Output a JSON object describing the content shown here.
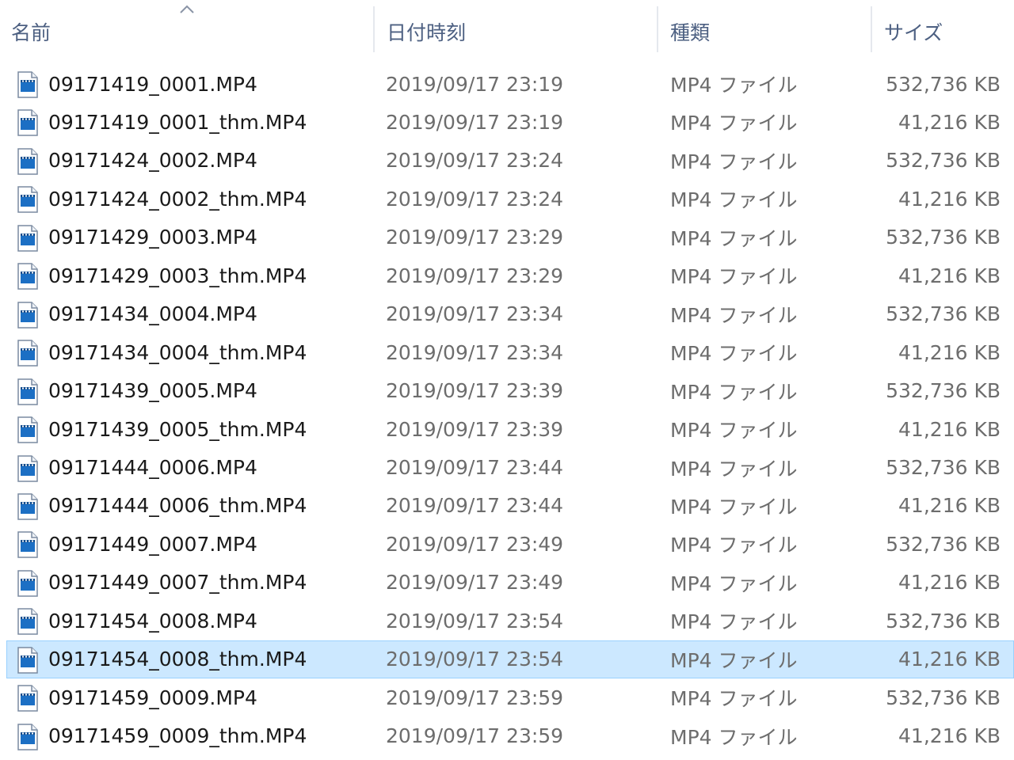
{
  "columns": {
    "name": "名前",
    "date": "日付時刻",
    "type": "種類",
    "size": "サイズ"
  },
  "sort": {
    "column": "name",
    "direction": "ascending",
    "icon": "chevron-up-icon"
  },
  "colors": {
    "header_text": "#4d6082",
    "selected_bg": "#cce8ff",
    "selected_border": "#99d1ff",
    "icon_blue": "#1c6fc4"
  },
  "files": [
    {
      "name": "09171419_0001.MP4",
      "date": "2019/09/17 23:19",
      "type": "MP4 ファイル",
      "size": "532,736 KB",
      "icon": "video-file-icon"
    },
    {
      "name": "09171419_0001_thm.MP4",
      "date": "2019/09/17 23:19",
      "type": "MP4 ファイル",
      "size": "41,216 KB",
      "icon": "video-file-icon"
    },
    {
      "name": "09171424_0002.MP4",
      "date": "2019/09/17 23:24",
      "type": "MP4 ファイル",
      "size": "532,736 KB",
      "icon": "video-file-icon"
    },
    {
      "name": "09171424_0002_thm.MP4",
      "date": "2019/09/17 23:24",
      "type": "MP4 ファイル",
      "size": "41,216 KB",
      "icon": "video-file-icon"
    },
    {
      "name": "09171429_0003.MP4",
      "date": "2019/09/17 23:29",
      "type": "MP4 ファイル",
      "size": "532,736 KB",
      "icon": "video-file-icon"
    },
    {
      "name": "09171429_0003_thm.MP4",
      "date": "2019/09/17 23:29",
      "type": "MP4 ファイル",
      "size": "41,216 KB",
      "icon": "video-file-icon"
    },
    {
      "name": "09171434_0004.MP4",
      "date": "2019/09/17 23:34",
      "type": "MP4 ファイル",
      "size": "532,736 KB",
      "icon": "video-file-icon"
    },
    {
      "name": "09171434_0004_thm.MP4",
      "date": "2019/09/17 23:34",
      "type": "MP4 ファイル",
      "size": "41,216 KB",
      "icon": "video-file-icon"
    },
    {
      "name": "09171439_0005.MP4",
      "date": "2019/09/17 23:39",
      "type": "MP4 ファイル",
      "size": "532,736 KB",
      "icon": "video-file-icon"
    },
    {
      "name": "09171439_0005_thm.MP4",
      "date": "2019/09/17 23:39",
      "type": "MP4 ファイル",
      "size": "41,216 KB",
      "icon": "video-file-icon"
    },
    {
      "name": "09171444_0006.MP4",
      "date": "2019/09/17 23:44",
      "type": "MP4 ファイル",
      "size": "532,736 KB",
      "icon": "video-file-icon"
    },
    {
      "name": "09171444_0006_thm.MP4",
      "date": "2019/09/17 23:44",
      "type": "MP4 ファイル",
      "size": "41,216 KB",
      "icon": "video-file-icon"
    },
    {
      "name": "09171449_0007.MP4",
      "date": "2019/09/17 23:49",
      "type": "MP4 ファイル",
      "size": "532,736 KB",
      "icon": "video-file-icon"
    },
    {
      "name": "09171449_0007_thm.MP4",
      "date": "2019/09/17 23:49",
      "type": "MP4 ファイル",
      "size": "41,216 KB",
      "icon": "video-file-icon"
    },
    {
      "name": "09171454_0008.MP4",
      "date": "2019/09/17 23:54",
      "type": "MP4 ファイル",
      "size": "532,736 KB",
      "icon": "video-file-icon"
    },
    {
      "name": "09171454_0008_thm.MP4",
      "date": "2019/09/17 23:54",
      "type": "MP4 ファイル",
      "size": "41,216 KB",
      "icon": "video-file-icon",
      "selected": true
    },
    {
      "name": "09171459_0009.MP4",
      "date": "2019/09/17 23:59",
      "type": "MP4 ファイル",
      "size": "532,736 KB",
      "icon": "video-file-icon"
    },
    {
      "name": "09171459_0009_thm.MP4",
      "date": "2019/09/17 23:59",
      "type": "MP4 ファイル",
      "size": "41,216 KB",
      "icon": "video-file-icon"
    }
  ]
}
